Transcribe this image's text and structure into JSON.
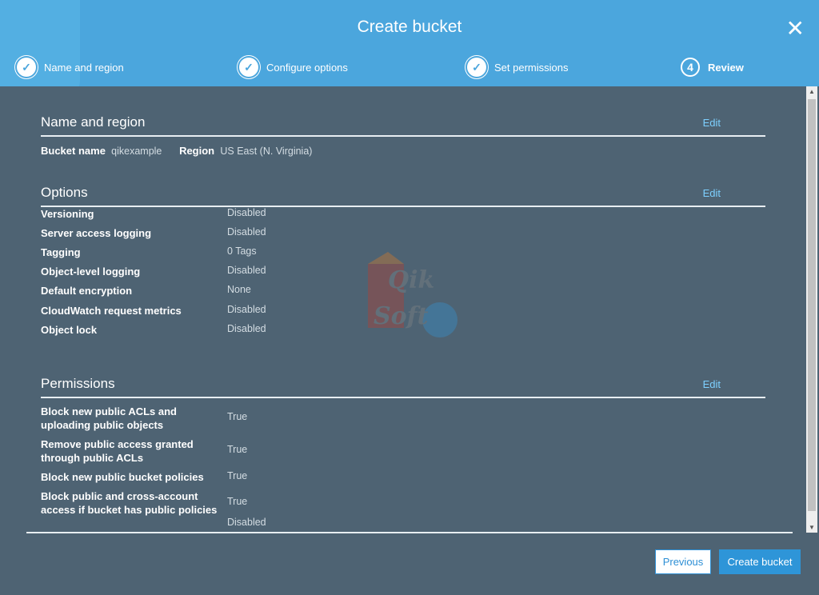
{
  "header": {
    "title": "Create bucket",
    "steps": [
      {
        "label": "Name and region",
        "state": "done"
      },
      {
        "label": "Configure options",
        "state": "done"
      },
      {
        "label": "Set permissions",
        "state": "done"
      },
      {
        "label": "Review",
        "number": "4",
        "state": "current"
      }
    ]
  },
  "name_region": {
    "heading": "Name and region",
    "edit": "Edit",
    "bucket_label": "Bucket name",
    "bucket_value": "qikexample",
    "region_label": "Region",
    "region_value": "US East (N. Virginia)"
  },
  "options": {
    "heading": "Options",
    "edit": "Edit",
    "rows": [
      {
        "label": "Versioning",
        "value": "Disabled"
      },
      {
        "label": "Server access logging",
        "value": "Disabled"
      },
      {
        "label": "Tagging",
        "value": "0 Tags"
      },
      {
        "label": "Object-level logging",
        "value": "Disabled"
      },
      {
        "label": "Default encryption",
        "value": "None"
      },
      {
        "label": "CloudWatch request metrics",
        "value": "Disabled"
      },
      {
        "label": "Object lock",
        "value": "Disabled"
      }
    ]
  },
  "permissions": {
    "heading": "Permissions",
    "edit": "Edit",
    "rows": [
      {
        "label": "Block new public ACLs and uploading public objects",
        "value": "True"
      },
      {
        "label": "Remove public access granted through public ACLs",
        "value": "True"
      },
      {
        "label": "Block new public bucket policies",
        "value": "True"
      },
      {
        "label": "Block public and cross-account access if bucket has public policies",
        "value": "True"
      },
      {
        "value": "Disabled"
      }
    ]
  },
  "watermark": "QikSoft",
  "footer": {
    "previous": "Previous",
    "create": "Create bucket"
  }
}
